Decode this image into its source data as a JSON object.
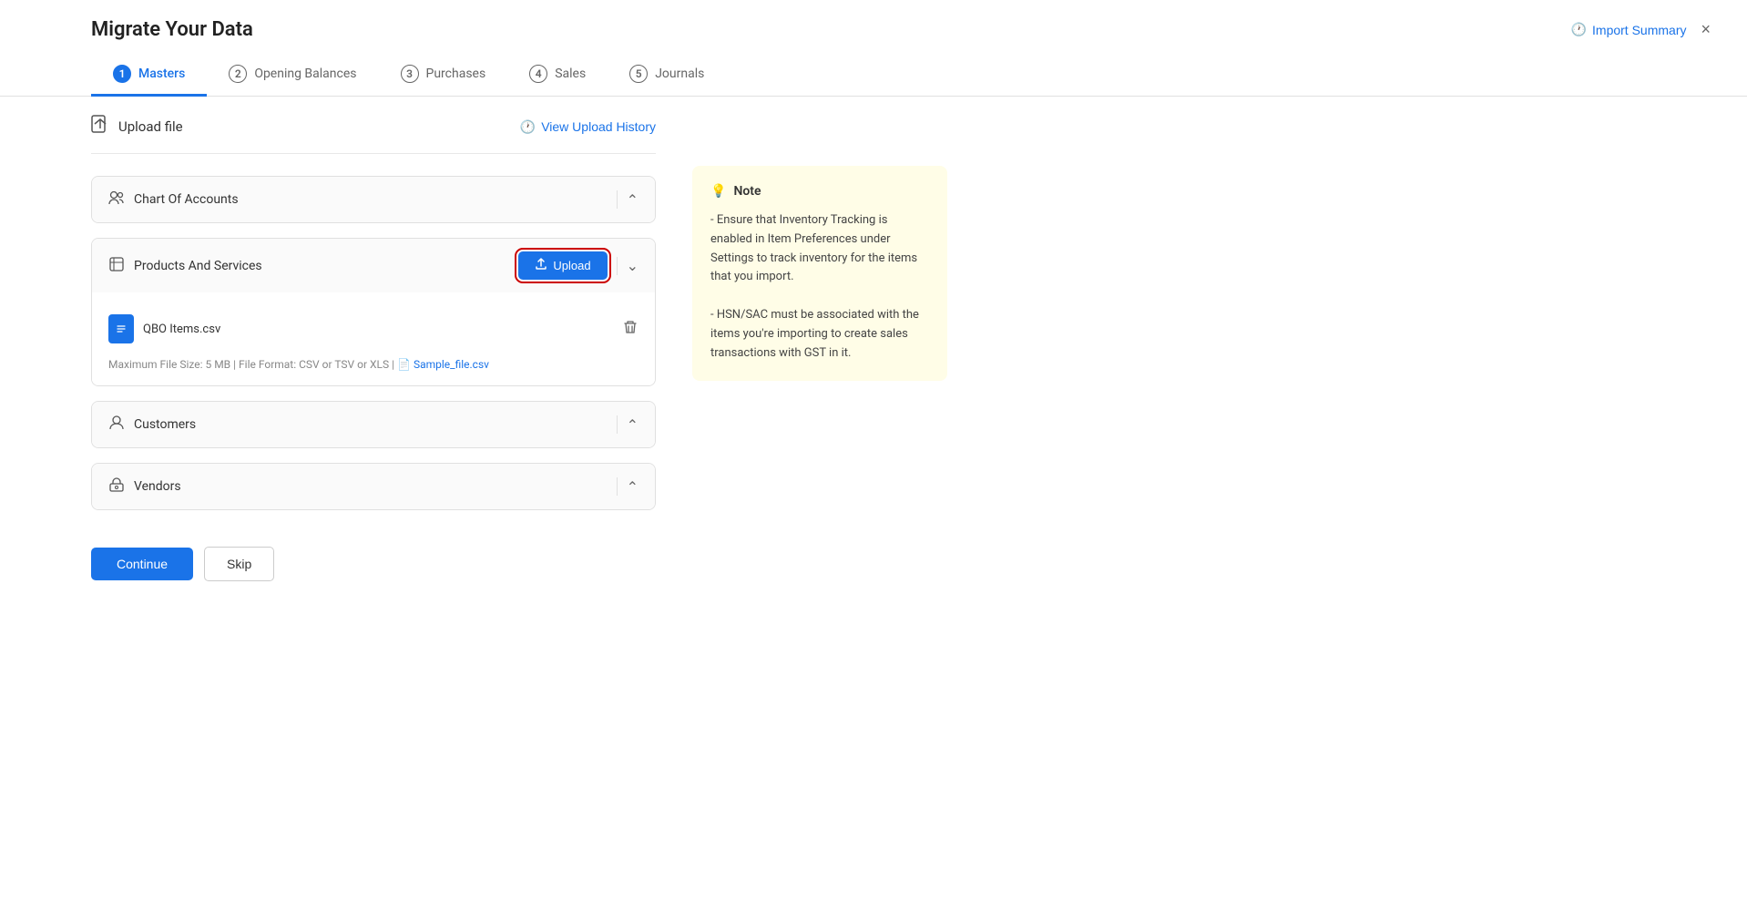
{
  "page": {
    "title": "Migrate Your Data"
  },
  "header": {
    "import_summary_label": "Import Summary",
    "close_label": "×"
  },
  "nav": {
    "tabs": [
      {
        "number": "1",
        "label": "Masters",
        "active": true
      },
      {
        "number": "2",
        "label": "Opening Balances",
        "active": false
      },
      {
        "number": "3",
        "label": "Purchases",
        "active": false
      },
      {
        "number": "4",
        "label": "Sales",
        "active": false
      },
      {
        "number": "5",
        "label": "Journals",
        "active": false
      }
    ]
  },
  "upload_file": {
    "title": "Upload file",
    "view_history_label": "View Upload History"
  },
  "sections": [
    {
      "id": "chart-of-accounts",
      "icon": "person-group-icon",
      "label": "Chart Of Accounts",
      "expanded": false,
      "show_upload": false
    },
    {
      "id": "products-and-services",
      "icon": "box-icon",
      "label": "Products And Services",
      "expanded": true,
      "show_upload": true,
      "upload_label": "Upload",
      "file": {
        "name": "QBO Items.csv",
        "meta": "Maximum File Size: 5 MB | File Format: CSV or TSV or XLS |",
        "sample_label": "Sample_file.csv"
      }
    },
    {
      "id": "customers",
      "icon": "person-icon",
      "label": "Customers",
      "expanded": false,
      "show_upload": false
    },
    {
      "id": "vendors",
      "icon": "vendor-icon",
      "label": "Vendors",
      "expanded": false,
      "show_upload": false
    }
  ],
  "note": {
    "title": "Note",
    "text": "- Ensure that Inventory Tracking is enabled in Item Preferences under Settings to track inventory for the items that you import.\n- HSN/SAC must be associated with the items you're importing to create sales transactions with GST in it."
  },
  "actions": {
    "continue_label": "Continue",
    "skip_label": "Skip"
  }
}
